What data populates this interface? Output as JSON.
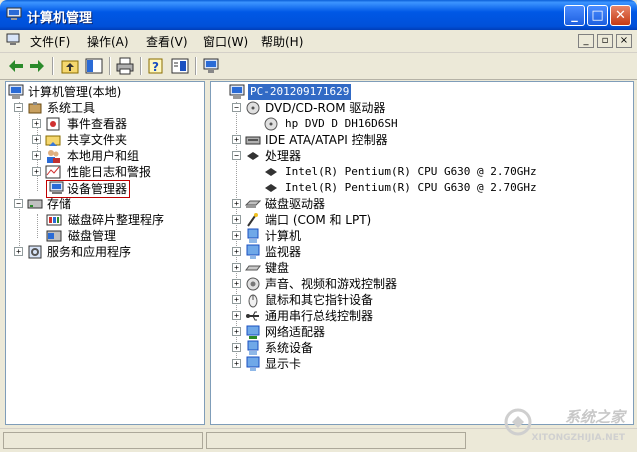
{
  "window": {
    "title": "计算机管理",
    "minimize": "_",
    "maximize": "□",
    "close": "✕"
  },
  "menu": {
    "items": [
      "文件(F)",
      "操作(A)",
      "查看(V)",
      "窗口(W)",
      "帮助(H)"
    ],
    "mdi_min": "_",
    "mdi_restore": "▫",
    "mdi_close": "×"
  },
  "left_tree": {
    "root": "计算机管理(本地)",
    "system_tools": "系统工具",
    "event_viewer": "事件查看器",
    "shared_folders": "共享文件夹",
    "local_users": "本地用户和组",
    "perf_logs": "性能日志和警报",
    "device_manager": "设备管理器",
    "storage": "存储",
    "defrag": "磁盘碎片整理程序",
    "disk_mgmt": "磁盘管理",
    "services_apps": "服务和应用程序"
  },
  "right_tree": {
    "computer": "PC-201209171629",
    "dvd": "DVD/CD-ROM 驱动器",
    "dvd_device": "hp DVD D  DH16D6SH",
    "ide": "IDE ATA/ATAPI 控制器",
    "processor": "处理器",
    "cpu1": "Intel(R) Pentium(R) CPU G630 @ 2.70GHz",
    "cpu2": "Intel(R) Pentium(R) CPU G630 @ 2.70GHz",
    "disk_drives": "磁盘驱动器",
    "ports": "端口 (COM 和 LPT)",
    "computer_node": "计算机",
    "monitors": "监视器",
    "keyboard": "键盘",
    "sound": "声音、视频和游戏控制器",
    "mouse": "鼠标和其它指针设备",
    "usb": "通用串行总线控制器",
    "network": "网络适配器",
    "system_devices": "系统设备",
    "display": "显示卡"
  },
  "expanders": {
    "plus": "+",
    "minus": "−"
  },
  "watermark": {
    "text": "系统之家",
    "url": "XITONGZHIJIA.NET"
  }
}
